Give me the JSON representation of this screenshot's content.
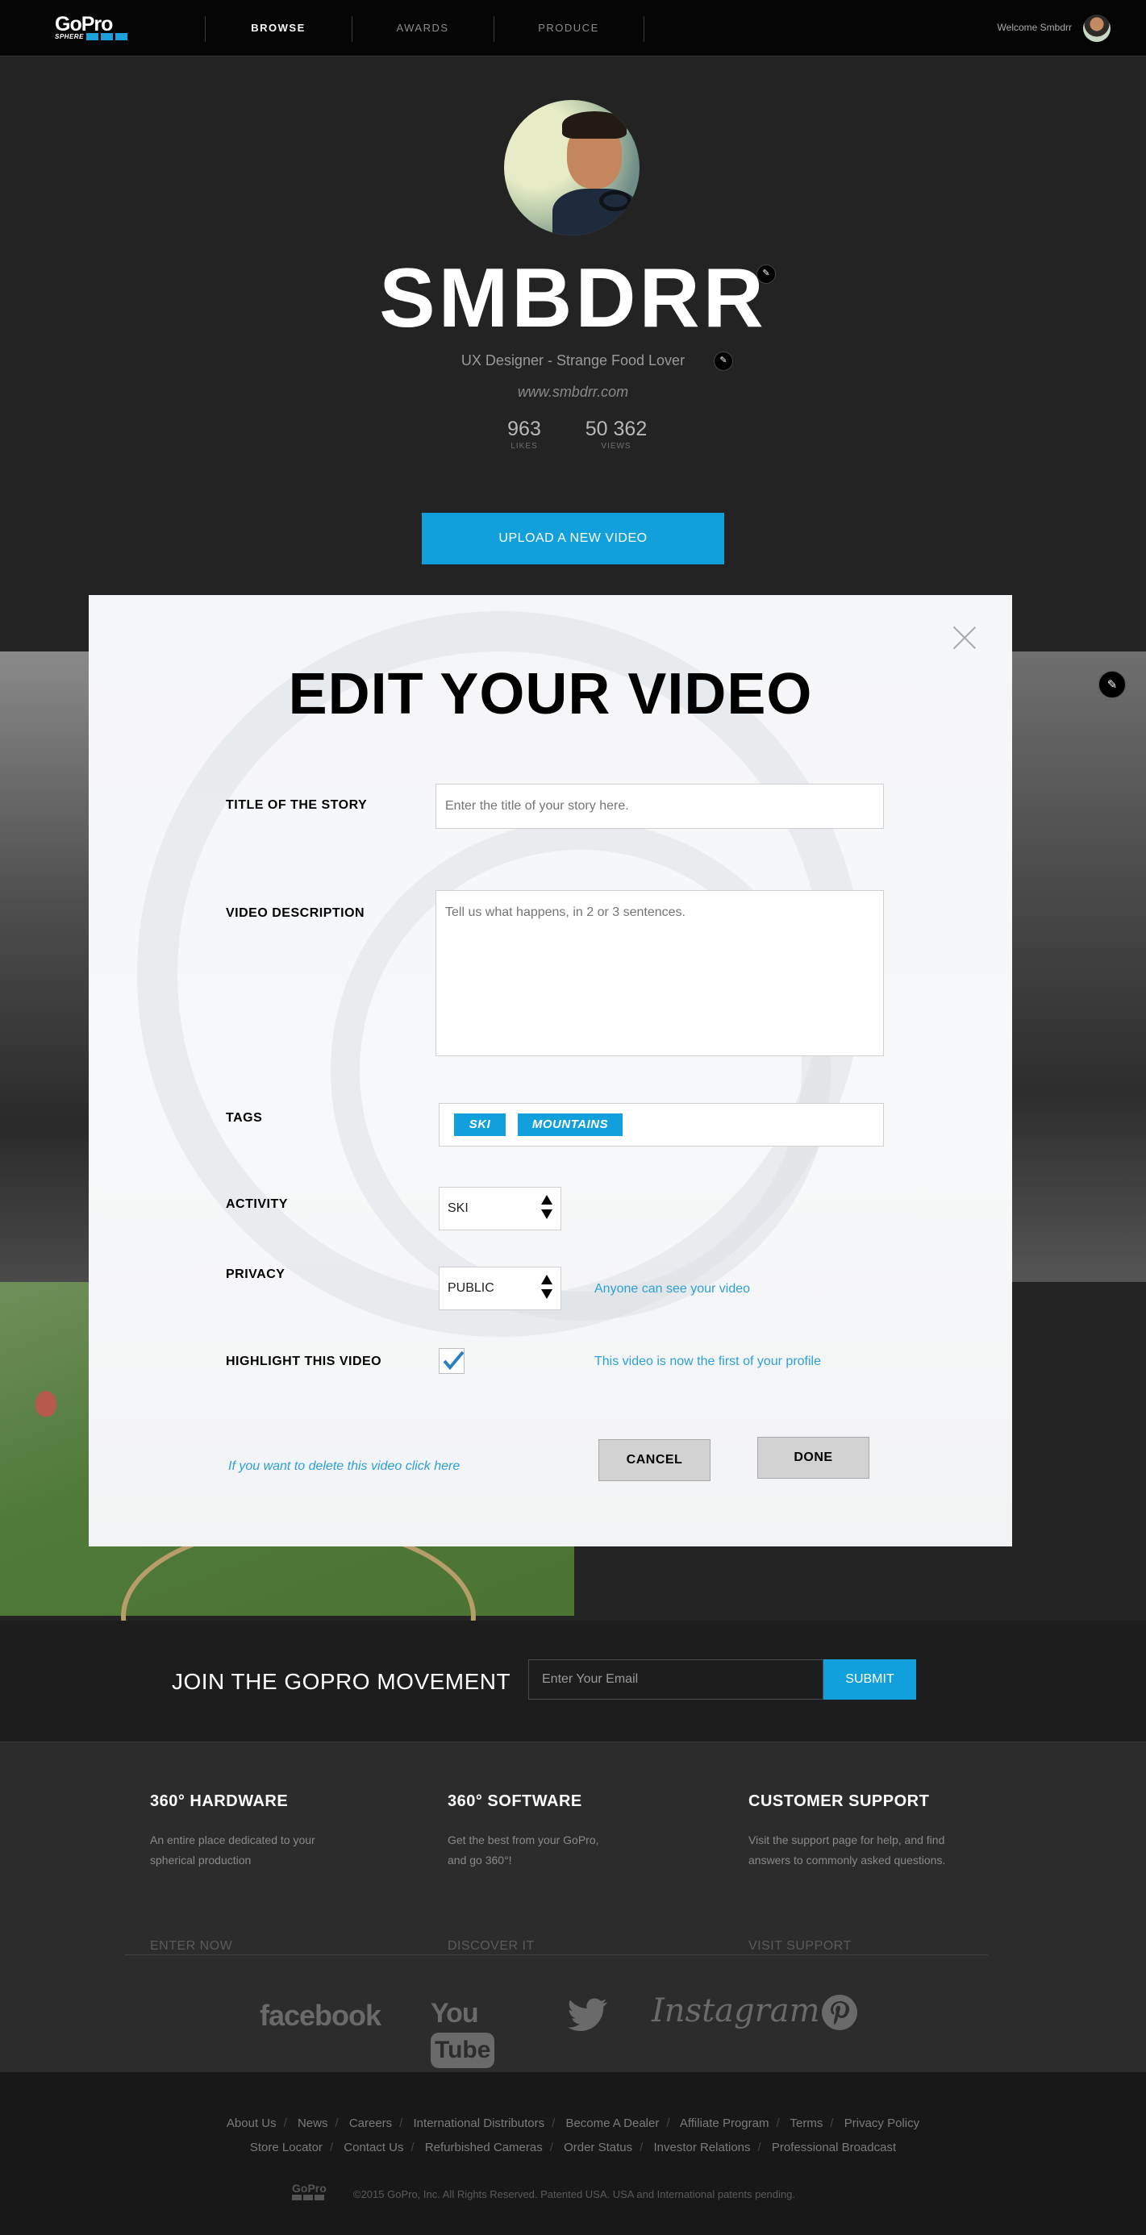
{
  "nav": {
    "logo_text": "GoPro",
    "logo_subtext": "SPHERE",
    "items": [
      {
        "label": "BROWSE",
        "active": true
      },
      {
        "label": "AWARDS",
        "active": false
      },
      {
        "label": "PRODUCE",
        "active": false
      }
    ],
    "welcome": "Welcome Smbdrr"
  },
  "profile": {
    "username": "SMBDRR",
    "tagline": "UX Designer - Strange Food Lover",
    "website": "www.smbdrr.com",
    "stats": [
      {
        "value": "963",
        "label": "LIKES"
      },
      {
        "value": "50 362",
        "label": "VIEWS"
      }
    ],
    "upload_label": "UPLOAD A NEW VIDEO"
  },
  "modal": {
    "title": "EDIT YOUR VIDEO",
    "story_title": {
      "label": "TITLE OF THE STORY",
      "placeholder": "Enter the title of your story here."
    },
    "description": {
      "label": "VIDEO DESCRIPTION",
      "placeholder": "Tell us what happens, in 2 or 3 sentences."
    },
    "tags": {
      "label": "TAGS",
      "items": [
        "SKI",
        "MOUNTAINS"
      ]
    },
    "activity": {
      "label": "ACTIVITY",
      "value": "SKI"
    },
    "privacy": {
      "label": "PRIVACY",
      "value": "PUBLIC",
      "hint": "Anyone can see your video"
    },
    "highlight": {
      "label": "HIGHLIGHT THIS VIDEO",
      "checked": true,
      "hint": "This video is now the first of your profile"
    },
    "delete_link": "If you want to delete this video click here",
    "cancel_label": "CANCEL",
    "done_label": "DONE"
  },
  "join": {
    "title": "JOIN THE GOPRO MOVEMENT",
    "email_placeholder": "Enter Your Email",
    "submit_label": "SUBMIT"
  },
  "footer": {
    "columns": [
      {
        "title": "360° HARDWARE",
        "text": "An entire place dedicated to your spherical production",
        "link": "ENTER NOW"
      },
      {
        "title": "360° SOFTWARE",
        "text": "Get the best from your GoPro, and go 360°!",
        "link": "DISCOVER IT"
      },
      {
        "title": "CUSTOMER SUPPORT",
        "text": "Visit the support page for help, and find answers to commonly asked questions.",
        "link": "VISIT SUPPORT"
      }
    ],
    "social": [
      "facebook",
      "YouTube",
      "twitter",
      "Instagram",
      "pinterest"
    ]
  },
  "bottom": {
    "links_row1": [
      "About Us",
      "News",
      "Careers",
      "International Distributors",
      "Become A Dealer",
      "Affiliate Program",
      "Terms",
      "Privacy Policy"
    ],
    "links_row2": [
      "Store Locator",
      "Contact Us",
      "Refurbished Cameras",
      "Order Status",
      "Investor Relations",
      "Professional Broadcast"
    ],
    "logo_text": "GoPro",
    "copyright": "©2015 GoPro, Inc. All Rights Reserved. Patented USA. USA and International patents pending."
  },
  "colors": {
    "accent": "#12a0dc",
    "hint": "#2e9fd6"
  }
}
